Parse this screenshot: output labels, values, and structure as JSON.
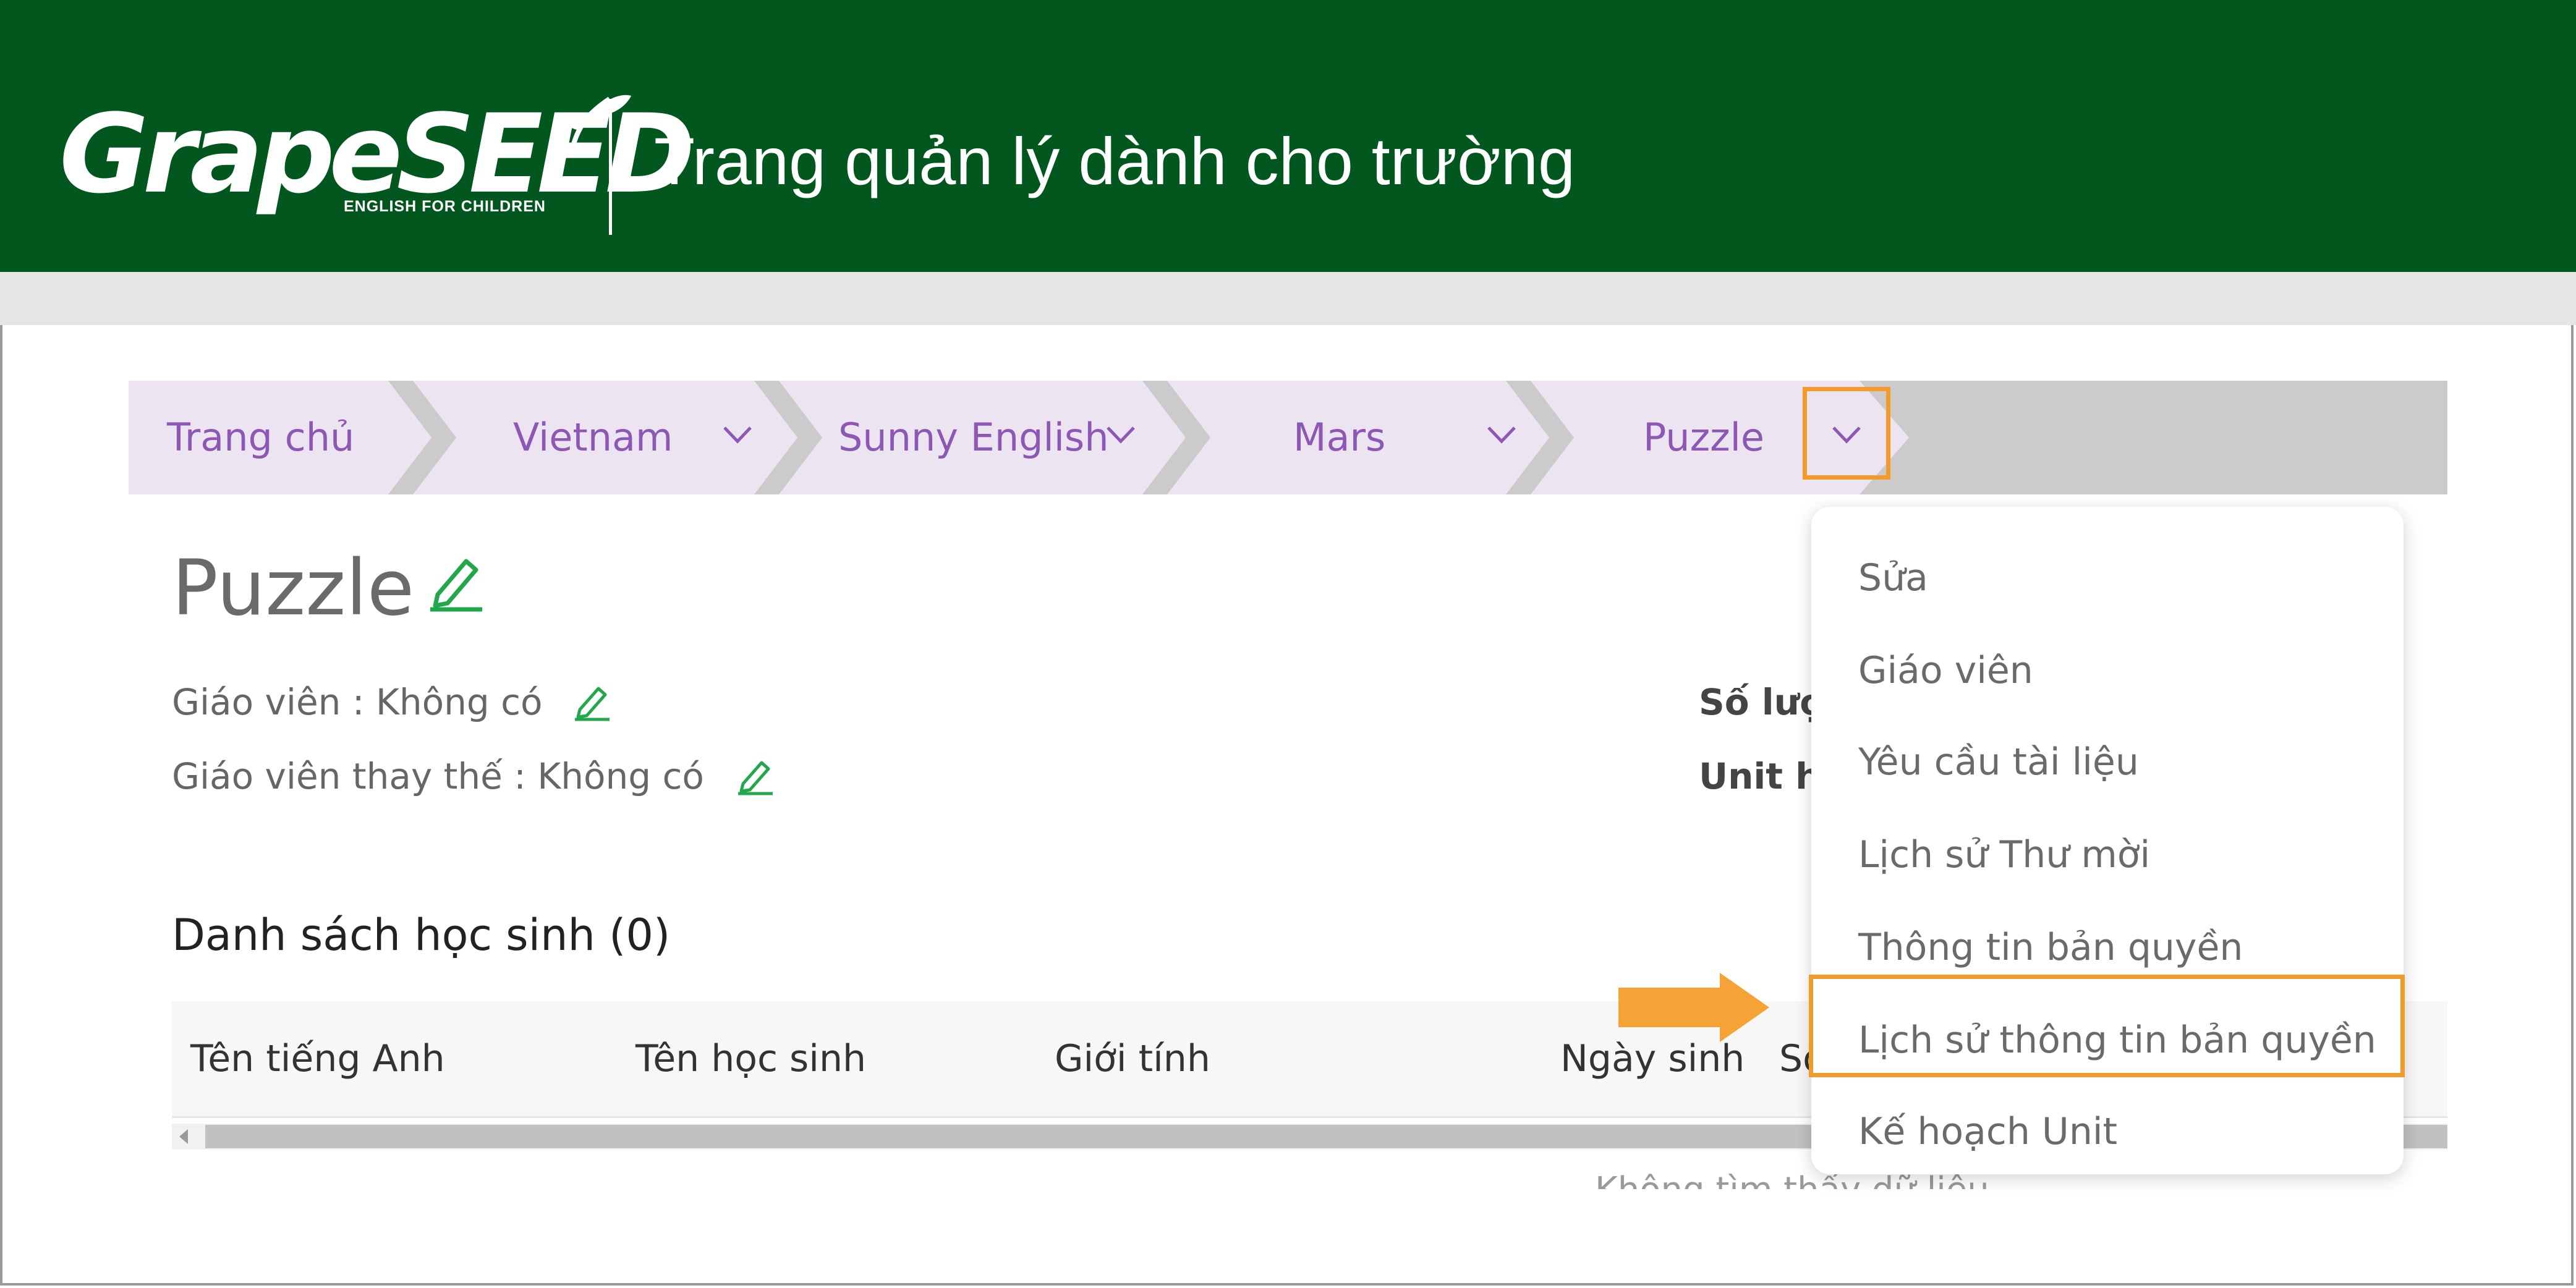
{
  "header": {
    "logo_text": "GrapeSEED",
    "logo_tagline": "ENGLISH FOR CHILDREN",
    "title": "Trang quản lý dành cho trường"
  },
  "breadcrumb": [
    {
      "label": "Trang chủ",
      "has_dropdown": false
    },
    {
      "label": "Vietnam",
      "has_dropdown": true
    },
    {
      "label": "Sunny English",
      "has_dropdown": true
    },
    {
      "label": "Mars",
      "has_dropdown": true
    },
    {
      "label": "Puzzle",
      "has_dropdown": true,
      "dropdown_open": true
    }
  ],
  "page": {
    "title": "Puzzle",
    "teacher_label": "Giáo viên : Không có",
    "substitute_label": "Giáo viên thay thế : Không có",
    "right_info_1": "Số lượ",
    "right_info_2": "Unit h",
    "student_list_title": "Danh sách học sinh (0)"
  },
  "table": {
    "columns": [
      "Tên tiếng Anh",
      "Tên học sinh",
      "Giới tính",
      "Ngày sinh",
      "Số"
    ],
    "empty_text": "Không tìm thấy dữ liệu"
  },
  "dropdown_menu": {
    "items": [
      "Sửa",
      "Giáo viên",
      "Yêu cầu tài liệu",
      "Lịch sử Thư mời",
      "Thông tin bản quyền",
      "Lịch sử thông tin bản quyền",
      "Kế hoạch Unit"
    ],
    "highlighted_item": "Lịch sử thông tin bản quyền"
  },
  "colors": {
    "header_bg": "#02571e",
    "breadcrumb_bg": "#ece4f1",
    "breadcrumb_text": "#8c58b4",
    "highlight": "#f39a2a",
    "edit_icon": "#22a84a"
  },
  "icons": {
    "edit": "pencil-icon",
    "dropdown": "chevron-down-icon",
    "callout": "arrow-right-icon"
  }
}
